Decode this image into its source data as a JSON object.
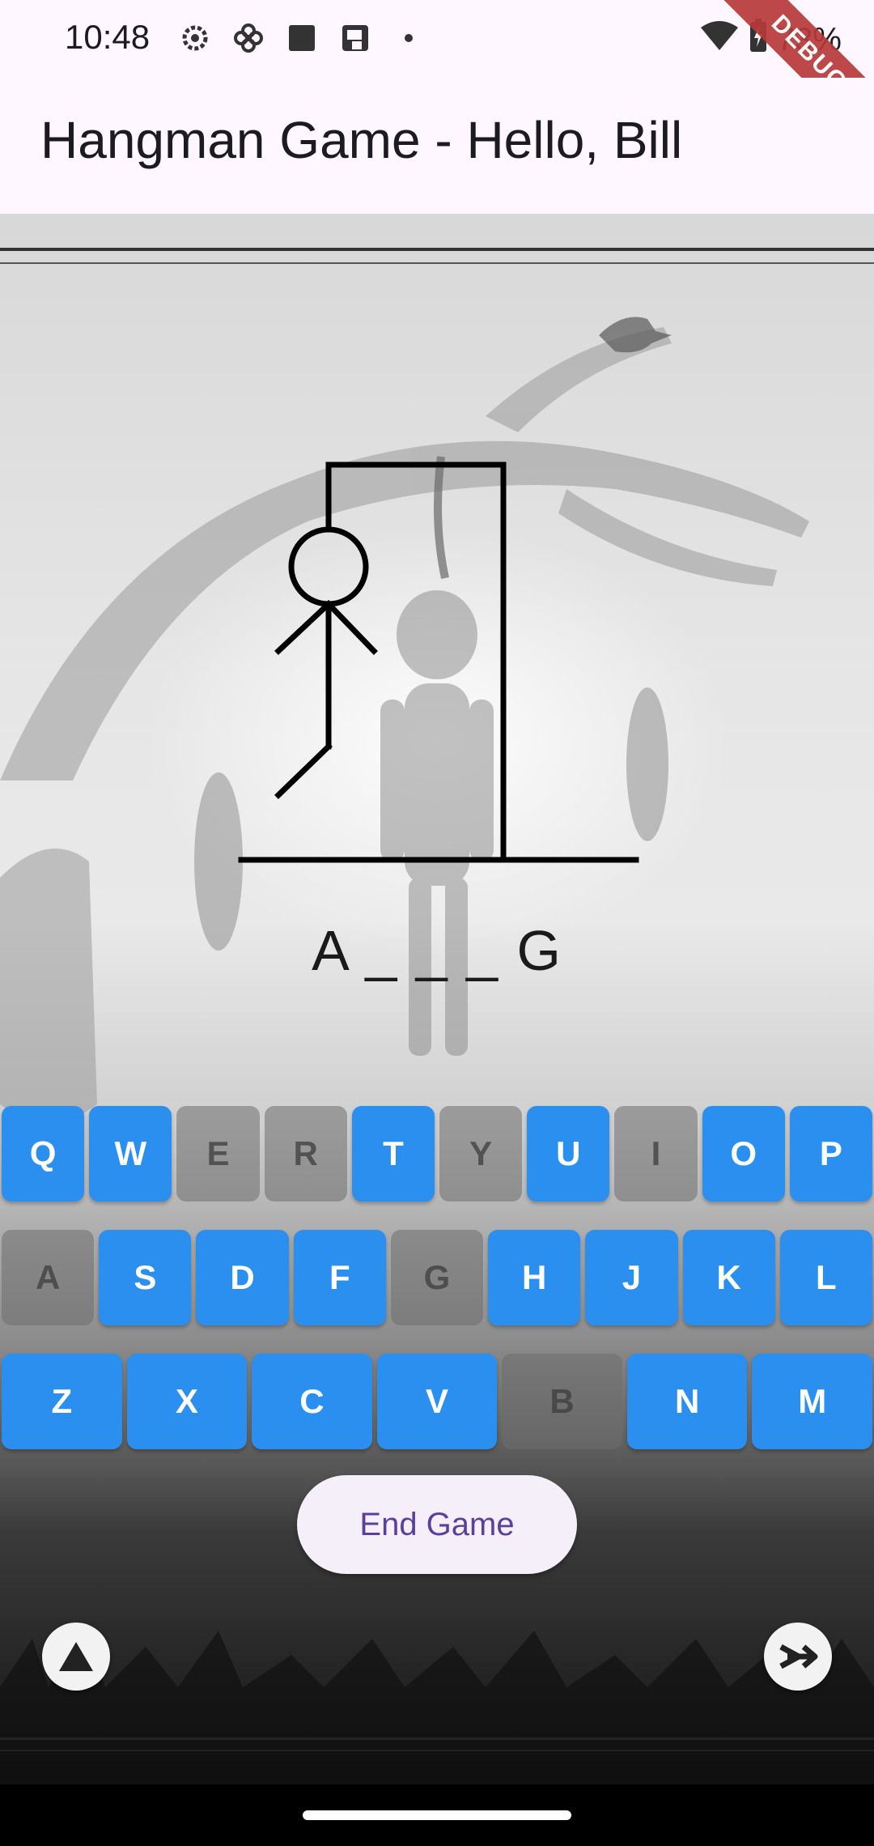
{
  "status_bar": {
    "time": "10:48",
    "battery": "73%",
    "debug_banner": "DEBUG",
    "icons": [
      "settings-icon",
      "pinwheel-icon",
      "square-icon",
      "cast-icon",
      "dot-icon",
      "wifi-icon",
      "battery-charging-icon"
    ]
  },
  "app_bar": {
    "title": "Hangman Game - Hello, Bill"
  },
  "game": {
    "word": "A _ _ _ G",
    "keyboard": {
      "rows": [
        [
          "Q",
          "W",
          "E",
          "R",
          "T",
          "Y",
          "U",
          "I",
          "O",
          "P"
        ],
        [
          "A",
          "S",
          "D",
          "F",
          "G",
          "H",
          "J",
          "K",
          "L"
        ],
        [
          "Z",
          "X",
          "C",
          "V",
          "B",
          "N",
          "M"
        ]
      ],
      "used_letters": [
        "E",
        "R",
        "Y",
        "I",
        "A",
        "G",
        "B"
      ]
    },
    "end_button_label": "End Game"
  },
  "colors": {
    "key_active": "#2b8ff0",
    "key_used": "#8a8a8a",
    "end_button_text": "#5b3f9e",
    "app_bar_bg": "#fef7ff"
  },
  "fab_icons": [
    "triangle-up-icon",
    "arrow-right-icon"
  ]
}
